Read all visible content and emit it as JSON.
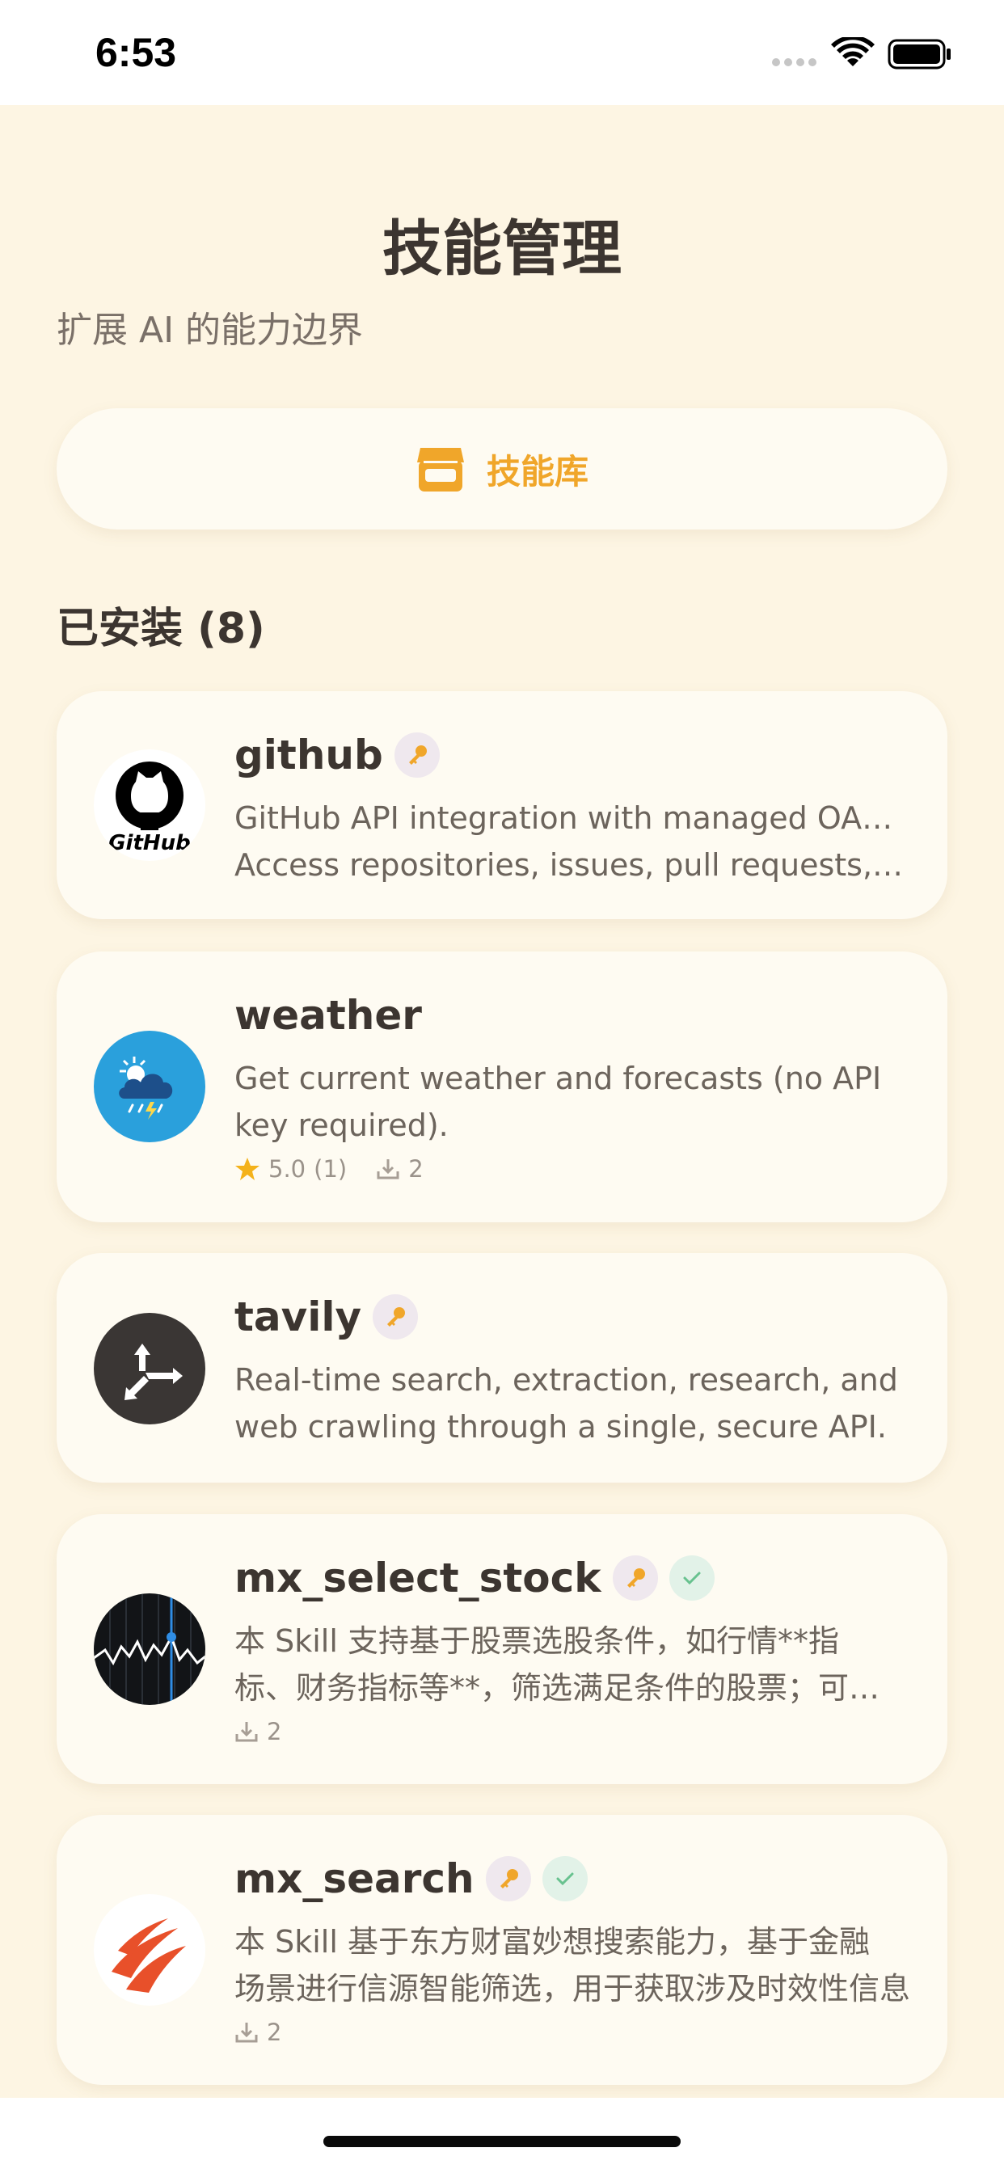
{
  "status_bar": {
    "time": "6:53"
  },
  "header": {
    "title": "技能管理",
    "subtitle": "扩展 AI 的能力边界"
  },
  "library_button": {
    "label": "技能库",
    "icon": "store-icon"
  },
  "installed": {
    "heading": "已安装 (8)"
  },
  "skills": [
    {
      "name": "github",
      "icon": "github-logo",
      "desc_line1": "GitHub API integration with managed OAuth.",
      "desc_line2": "Access repositories, issues, pull requests, and more."
    },
    {
      "name": "weather",
      "icon": "weather-cloud-icon",
      "desc_line1": "Get current weather and forecasts (no API",
      "desc_line2": "key required).",
      "rating": "5.0",
      "rating_count": "(1)",
      "downloads": "2"
    },
    {
      "name": "tavily",
      "icon": "tavily-arrows-logo",
      "desc_line1": "Real-time search, extraction, research, and",
      "desc_line2": "web crawling through a single, secure API."
    },
    {
      "name": "mx_select_stock",
      "icon": "stock-chart-icon",
      "desc_line1": "本 Skill 支持基于股票选股条件，如行情**指",
      "desc_line2": "标、财务指标等**，筛选满足条件的股票；可根据条件选股",
      "downloads": "2"
    },
    {
      "name": "mx_search",
      "icon": "eastmoney-logo",
      "desc_line1": "本 Skill 基于东方财富妙想搜索能力，基于金融",
      "desc_line2": "场景进行信源智能筛选，用于获取涉及时效性信息",
      "downloads": "2"
    }
  ],
  "colors": {
    "background": "#fdf5e3",
    "card": "#fefbf2",
    "accent": "#f0a62a",
    "text": "#3c3530"
  }
}
